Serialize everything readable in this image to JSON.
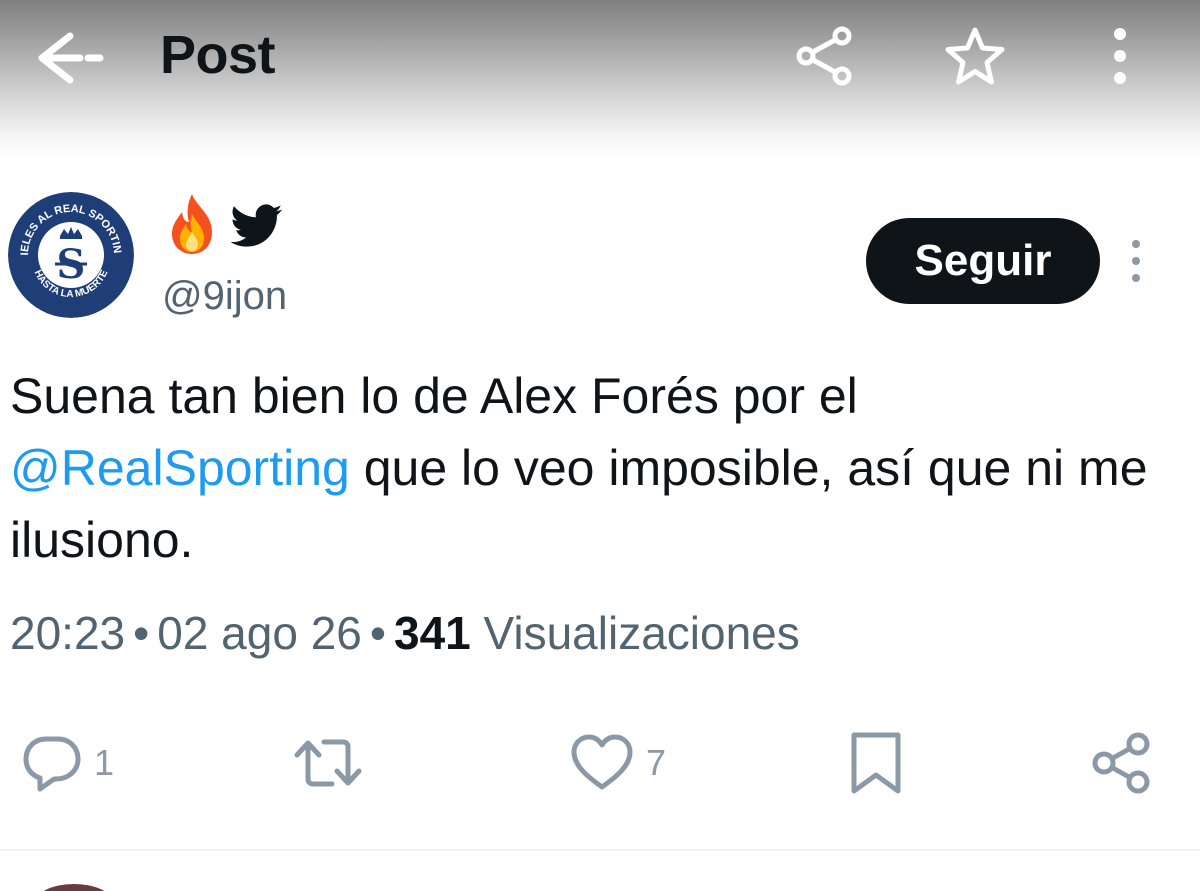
{
  "header": {
    "title": "Post",
    "back_icon": "arrow-left-icon",
    "share_icon": "share-icon",
    "bookmark_icon": "star-icon",
    "more_icon": "more-vertical-icon"
  },
  "author": {
    "avatar": {
      "top_text": "FIELES AL REAL SPORTING",
      "bottom_text": "HASTA LA MUERTE",
      "monogram": "S",
      "bg_color": "#1f3e78"
    },
    "name_emojis": [
      "fire-emoji",
      "twitter-bird-icon"
    ],
    "handle": "@9ijon",
    "follow_label": "Seguir"
  },
  "tweet": {
    "text_before": "Suena tan bien lo de Alex Forés por el ",
    "mention": "@RealSporting",
    "text_after": " que lo veo imposible, así que ni me ilusiono."
  },
  "meta": {
    "time": "20:23",
    "date": "02 ago 26",
    "views_count": "341",
    "views_label": "Visualizaciones",
    "separator": "•"
  },
  "actions": {
    "reply_count": "1",
    "retweet_count": "",
    "like_count": "7"
  },
  "colors": {
    "text": "#0f1419",
    "secondary": "#536471",
    "mention": "#1d9bf0",
    "icon": "#8b98a5",
    "button_bg": "#0f1419"
  }
}
